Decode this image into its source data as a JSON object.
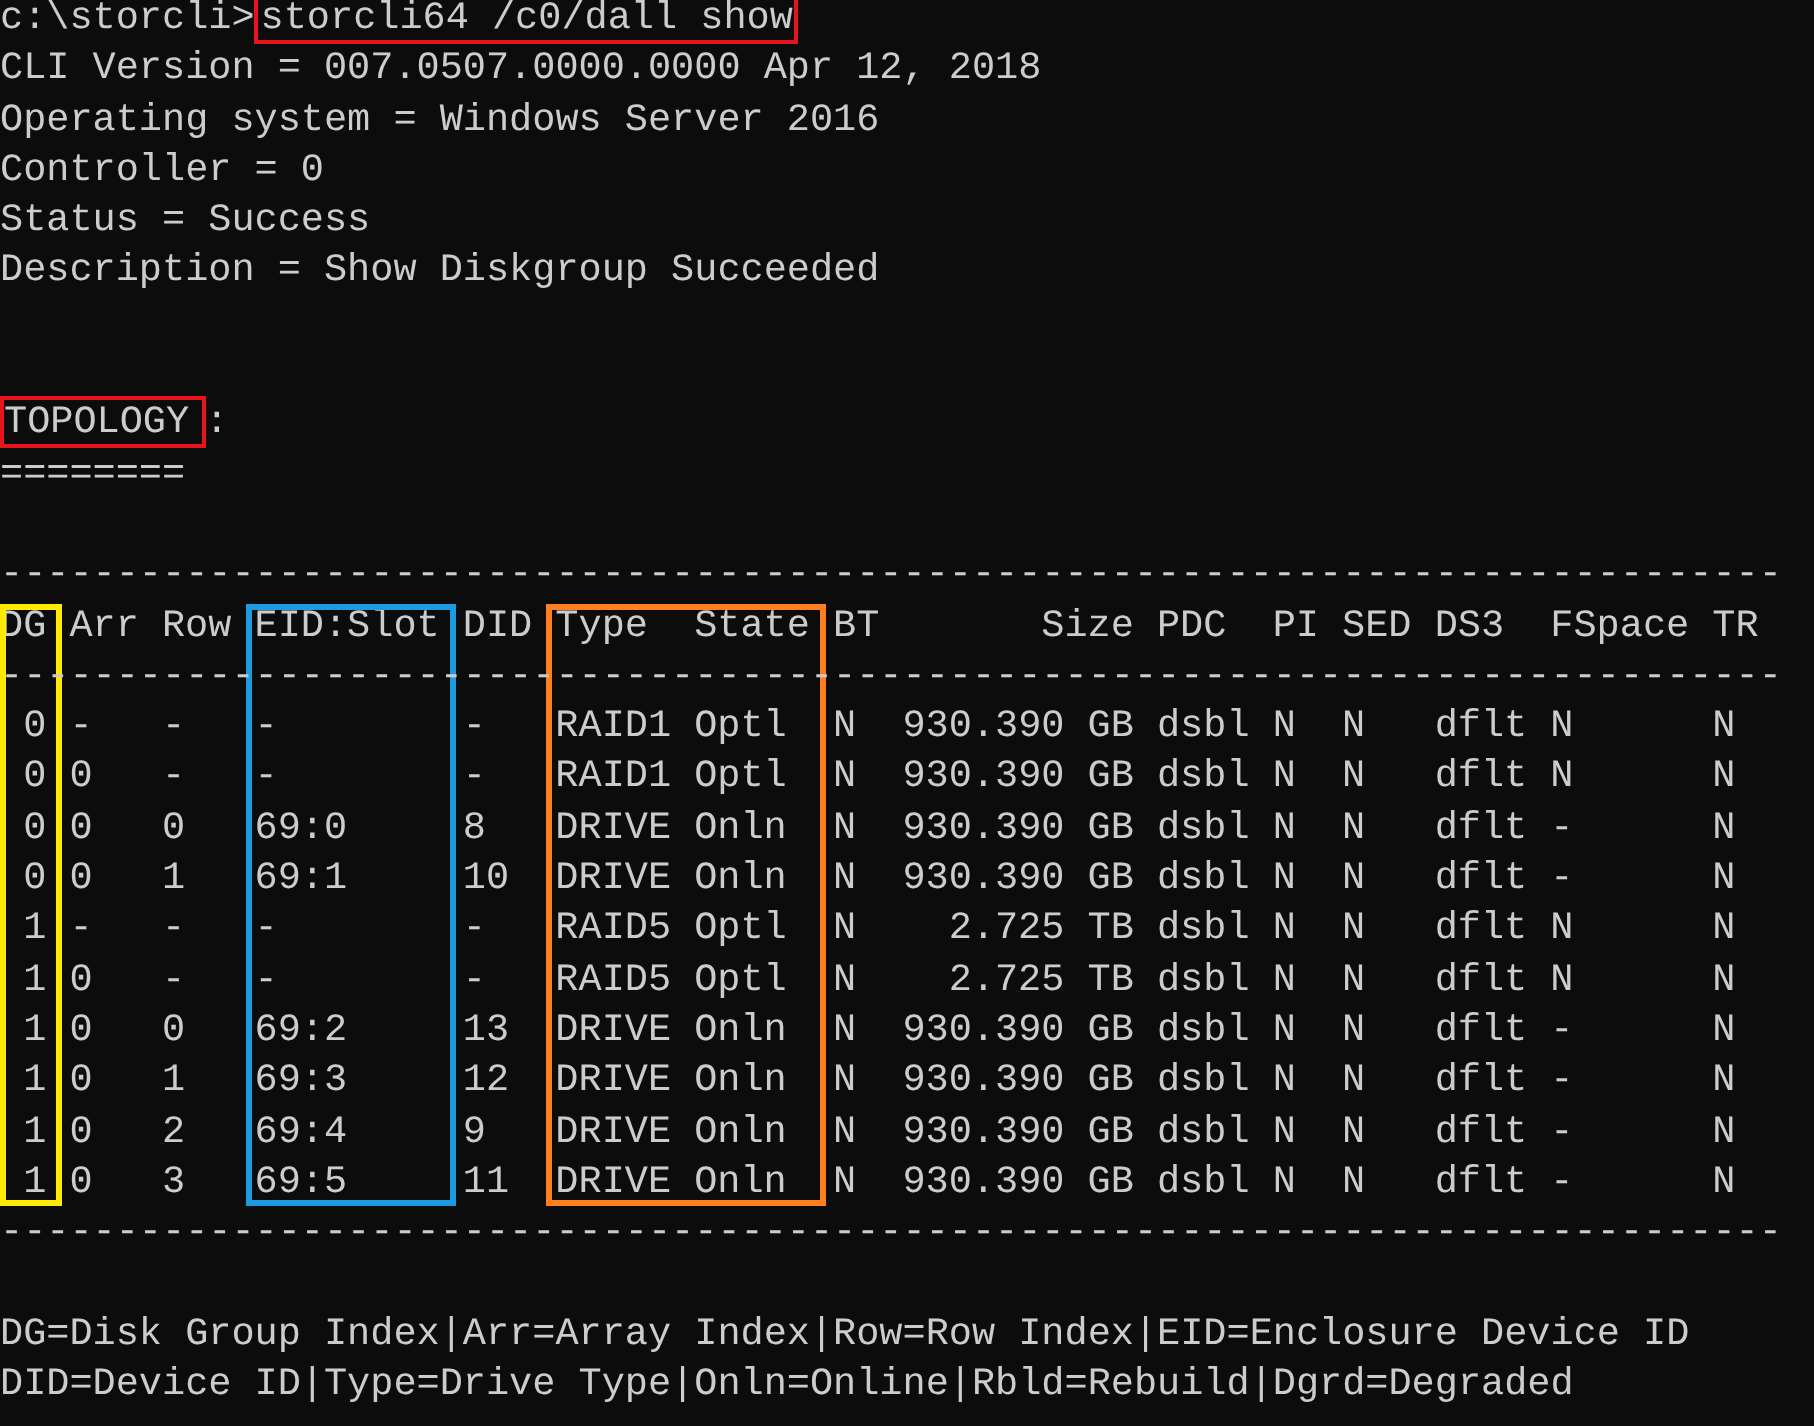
{
  "command": {
    "prompt": "c:\\storcli>",
    "text": "storcli64 /c0/dall show",
    "highlighted": true
  },
  "output_lines": [
    "CLI Version = 007.0507.0000.0000 Apr 12, 2018",
    "Operating system = Windows Server 2016",
    "Controller = 0",
    "Status = Success",
    "Description = Show Diskgroup Succeeded"
  ],
  "section": {
    "title": "TOPOLOGY",
    "suffix": ":",
    "highlighted": true,
    "underline": "========"
  },
  "table": {
    "rule": "-----------------------------------------------------------------------------",
    "columns": [
      {
        "label": "DG",
        "color": "#ffea00"
      },
      {
        "label": "Arr"
      },
      {
        "label": "Row"
      },
      {
        "label": "EID:Slot",
        "color": "#1e9be0"
      },
      {
        "label": "DID"
      },
      {
        "label": "Type",
        "color": "#ff7f1e"
      },
      {
        "label": "State",
        "color": "#ff7f1e"
      },
      {
        "label": "BT"
      },
      {
        "label": "Size"
      },
      {
        "label": "PDC"
      },
      {
        "label": "PI"
      },
      {
        "label": "SED"
      },
      {
        "label": "DS3"
      },
      {
        "label": "FSpace"
      },
      {
        "label": "TR"
      }
    ],
    "rows": [
      [
        "0",
        "-",
        "-",
        "-",
        "-",
        "RAID1",
        "Optl",
        "N",
        "930.390 GB",
        "dsbl",
        "N",
        "N",
        "dflt",
        "N",
        "N"
      ],
      [
        "0",
        "0",
        "-",
        "-",
        "-",
        "RAID1",
        "Optl",
        "N",
        "930.390 GB",
        "dsbl",
        "N",
        "N",
        "dflt",
        "N",
        "N"
      ],
      [
        "0",
        "0",
        "0",
        "69:0",
        "8",
        "DRIVE",
        "Onln",
        "N",
        "930.390 GB",
        "dsbl",
        "N",
        "N",
        "dflt",
        "-",
        "N"
      ],
      [
        "0",
        "0",
        "1",
        "69:1",
        "10",
        "DRIVE",
        "Onln",
        "N",
        "930.390 GB",
        "dsbl",
        "N",
        "N",
        "dflt",
        "-",
        "N"
      ],
      [
        "1",
        "-",
        "-",
        "-",
        "-",
        "RAID5",
        "Optl",
        "N",
        "2.725 TB",
        "dsbl",
        "N",
        "N",
        "dflt",
        "N",
        "N"
      ],
      [
        "1",
        "0",
        "-",
        "-",
        "-",
        "RAID5",
        "Optl",
        "N",
        "2.725 TB",
        "dsbl",
        "N",
        "N",
        "dflt",
        "N",
        "N"
      ],
      [
        "1",
        "0",
        "0",
        "69:2",
        "13",
        "DRIVE",
        "Onln",
        "N",
        "930.390 GB",
        "dsbl",
        "N",
        "N",
        "dflt",
        "-",
        "N"
      ],
      [
        "1",
        "0",
        "1",
        "69:3",
        "12",
        "DRIVE",
        "Onln",
        "N",
        "930.390 GB",
        "dsbl",
        "N",
        "N",
        "dflt",
        "-",
        "N"
      ],
      [
        "1",
        "0",
        "2",
        "69:4",
        "9",
        "DRIVE",
        "Onln",
        "N",
        "930.390 GB",
        "dsbl",
        "N",
        "N",
        "dflt",
        "-",
        "N"
      ],
      [
        "1",
        "0",
        "3",
        "69:5",
        "11",
        "DRIVE",
        "Onln",
        "N",
        "930.390 GB",
        "dsbl",
        "N",
        "N",
        "dflt",
        "-",
        "N"
      ]
    ]
  },
  "legend": [
    "DG=Disk Group Index|Arr=Array Index|Row=Row Index|EID=Enclosure Device ID",
    "DID=Device ID|Type=Drive Type|Onln=Online|Rbld=Rebuild|Dgrd=Degraded"
  ]
}
